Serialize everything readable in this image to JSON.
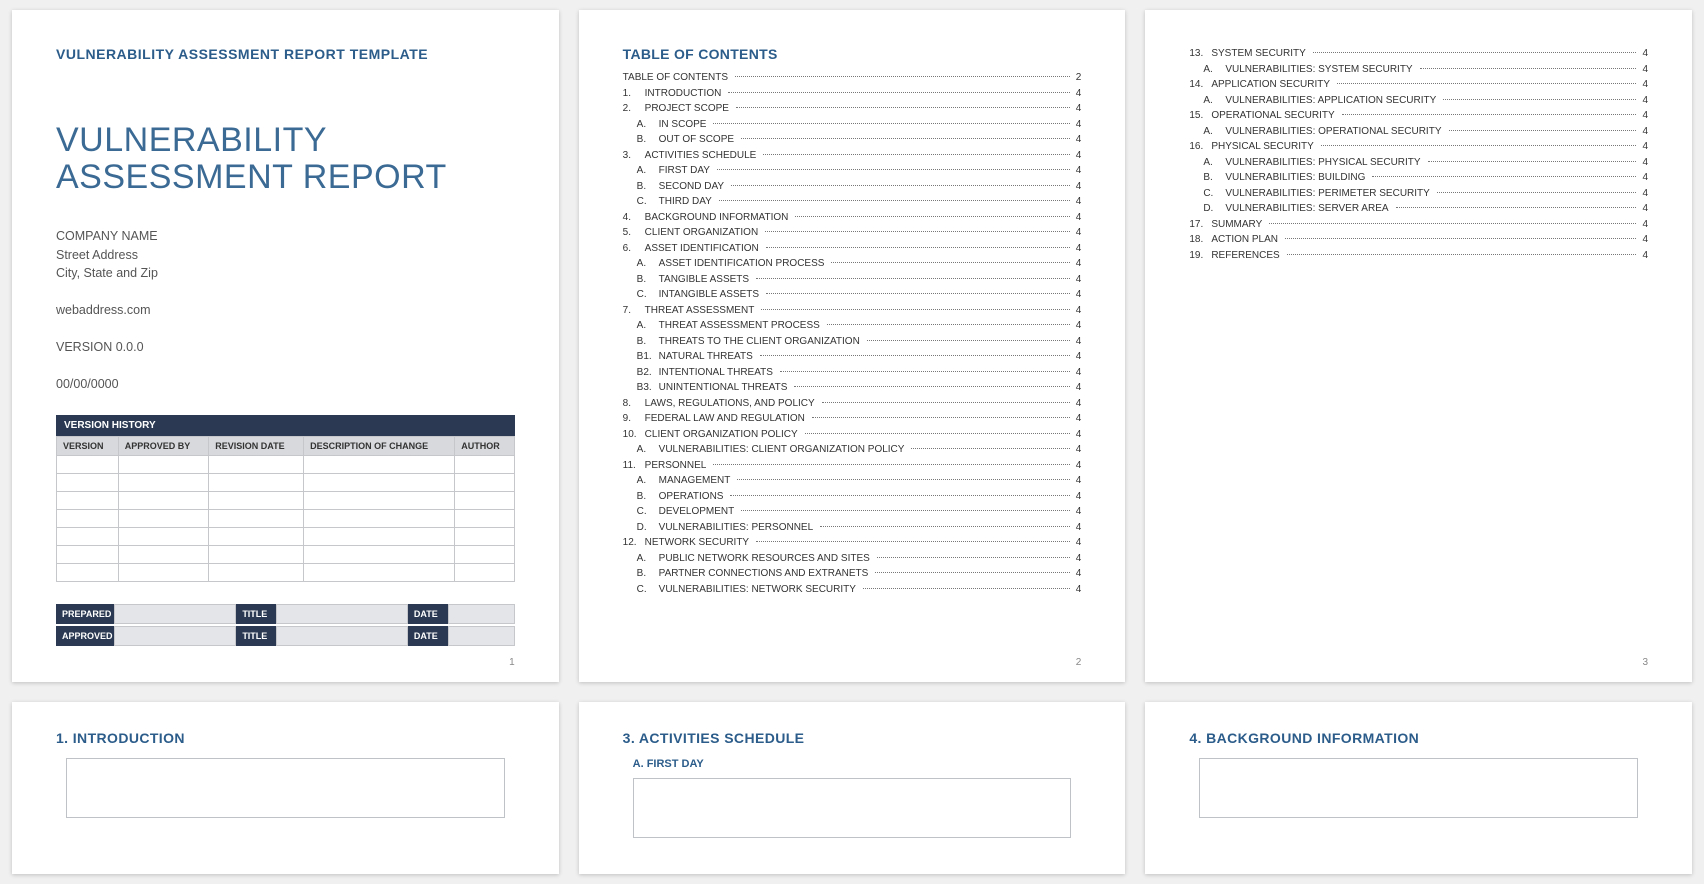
{
  "page1": {
    "template_label": "VULNERABILITY ASSESSMENT REPORT TEMPLATE",
    "title": "VULNERABILITY ASSESSMENT REPORT",
    "company": "COMPANY NAME",
    "street": "Street Address",
    "csz": "City, State and Zip",
    "web": "webaddress.com",
    "version": "VERSION 0.0.0",
    "date": "00/00/0000",
    "vh_header": "VERSION HISTORY",
    "vh_cols": {
      "c1": "VERSION",
      "c2": "APPROVED BY",
      "c3": "REVISION DATE",
      "c4": "DESCRIPTION OF CHANGE",
      "c5": "AUTHOR"
    },
    "sig": {
      "prepared": "PREPARED BY",
      "approved": "APPROVED BY",
      "title": "TITLE",
      "date": "DATE"
    },
    "pagenum": "1"
  },
  "page2": {
    "heading": "TABLE OF CONTENTS",
    "items": [
      {
        "n": "",
        "t": "TABLE OF CONTENTS",
        "p": "2",
        "cls": "top"
      },
      {
        "n": "1.",
        "t": "INTRODUCTION",
        "p": "4"
      },
      {
        "n": "2.",
        "t": "PROJECT SCOPE",
        "p": "4"
      },
      {
        "n": "A.",
        "t": "IN SCOPE",
        "p": "4",
        "cls": "sub"
      },
      {
        "n": "B.",
        "t": "OUT OF SCOPE",
        "p": "4",
        "cls": "sub"
      },
      {
        "n": "3.",
        "t": "ACTIVITIES SCHEDULE",
        "p": "4"
      },
      {
        "n": "A.",
        "t": "FIRST DAY",
        "p": "4",
        "cls": "sub"
      },
      {
        "n": "B.",
        "t": "SECOND DAY",
        "p": "4",
        "cls": "sub"
      },
      {
        "n": "C.",
        "t": "THIRD DAY",
        "p": "4",
        "cls": "sub"
      },
      {
        "n": "4.",
        "t": "BACKGROUND INFORMATION",
        "p": "4"
      },
      {
        "n": "5.",
        "t": "CLIENT ORGANIZATION",
        "p": "4"
      },
      {
        "n": "6.",
        "t": "ASSET IDENTIFICATION",
        "p": "4"
      },
      {
        "n": "A.",
        "t": "ASSET IDENTIFICATION PROCESS",
        "p": "4",
        "cls": "sub"
      },
      {
        "n": "B.",
        "t": "TANGIBLE ASSETS",
        "p": "4",
        "cls": "sub"
      },
      {
        "n": "C.",
        "t": "INTANGIBLE ASSETS",
        "p": "4",
        "cls": "sub"
      },
      {
        "n": "7.",
        "t": "THREAT ASSESSMENT",
        "p": "4"
      },
      {
        "n": "A.",
        "t": "THREAT ASSESSMENT PROCESS",
        "p": "4",
        "cls": "sub"
      },
      {
        "n": "B.",
        "t": "THREATS TO THE CLIENT ORGANIZATION",
        "p": "4",
        "cls": "sub"
      },
      {
        "n": "B1.",
        "t": "NATURAL THREATS",
        "p": "4",
        "cls": "sub"
      },
      {
        "n": "B2.",
        "t": "INTENTIONAL THREATS",
        "p": "4",
        "cls": "sub"
      },
      {
        "n": "B3.",
        "t": "UNINTENTIONAL THREATS",
        "p": "4",
        "cls": "sub"
      },
      {
        "n": "8.",
        "t": "LAWS, REGULATIONS, AND POLICY",
        "p": "4"
      },
      {
        "n": "9.",
        "t": "FEDERAL LAW AND REGULATION",
        "p": "4"
      },
      {
        "n": "10.",
        "t": "CLIENT ORGANIZATION POLICY",
        "p": "4"
      },
      {
        "n": "A.",
        "t": "VULNERABILITIES: CLIENT ORGANIZATION POLICY",
        "p": "4",
        "cls": "sub"
      },
      {
        "n": "11.",
        "t": "PERSONNEL",
        "p": "4"
      },
      {
        "n": "A.",
        "t": "MANAGEMENT",
        "p": "4",
        "cls": "sub"
      },
      {
        "n": "B.",
        "t": "OPERATIONS",
        "p": "4",
        "cls": "sub"
      },
      {
        "n": "C.",
        "t": "DEVELOPMENT",
        "p": "4",
        "cls": "sub"
      },
      {
        "n": "D.",
        "t": "VULNERABILITIES: PERSONNEL",
        "p": "4",
        "cls": "sub"
      },
      {
        "n": "12.",
        "t": "NETWORK SECURITY",
        "p": "4"
      },
      {
        "n": "A.",
        "t": "PUBLIC NETWORK RESOURCES AND SITES",
        "p": "4",
        "cls": "sub"
      },
      {
        "n": "B.",
        "t": "PARTNER CONNECTIONS AND EXTRANETS",
        "p": "4",
        "cls": "sub"
      },
      {
        "n": "C.",
        "t": "VULNERABILITIES: NETWORK SECURITY",
        "p": "4",
        "cls": "sub"
      }
    ],
    "pagenum": "2"
  },
  "page3": {
    "items": [
      {
        "n": "13.",
        "t": "SYSTEM SECURITY",
        "p": "4"
      },
      {
        "n": "A.",
        "t": "VULNERABILITIES: SYSTEM SECURITY",
        "p": "4",
        "cls": "sub"
      },
      {
        "n": "14.",
        "t": "APPLICATION SECURITY",
        "p": "4"
      },
      {
        "n": "A.",
        "t": "VULNERABILITIES: APPLICATION SECURITY",
        "p": "4",
        "cls": "sub"
      },
      {
        "n": "15.",
        "t": "OPERATIONAL SECURITY",
        "p": "4"
      },
      {
        "n": "A.",
        "t": "VULNERABILITIES: OPERATIONAL SECURITY",
        "p": "4",
        "cls": "sub"
      },
      {
        "n": "16.",
        "t": "PHYSICAL SECURITY",
        "p": "4"
      },
      {
        "n": "A.",
        "t": "VULNERABILITIES: PHYSICAL SECURITY",
        "p": "4",
        "cls": "sub"
      },
      {
        "n": "B.",
        "t": "VULNERABILITIES: BUILDING",
        "p": "4",
        "cls": "sub"
      },
      {
        "n": "C.",
        "t": "VULNERABILITIES: PERIMETER SECURITY",
        "p": "4",
        "cls": "sub"
      },
      {
        "n": "D.",
        "t": "VULNERABILITIES: SERVER AREA",
        "p": "4",
        "cls": "sub"
      },
      {
        "n": "17.",
        "t": "SUMMARY",
        "p": "4"
      },
      {
        "n": "18.",
        "t": "ACTION PLAN",
        "p": "4"
      },
      {
        "n": "19.",
        "t": "REFERENCES",
        "p": "4"
      }
    ],
    "pagenum": "3"
  },
  "page4": {
    "heading": "1.  INTRODUCTION"
  },
  "page5": {
    "heading": "3.  ACTIVITIES SCHEDULE",
    "sub": "A.  FIRST DAY"
  },
  "page6": {
    "heading": "4.  BACKGROUND INFORMATION"
  }
}
